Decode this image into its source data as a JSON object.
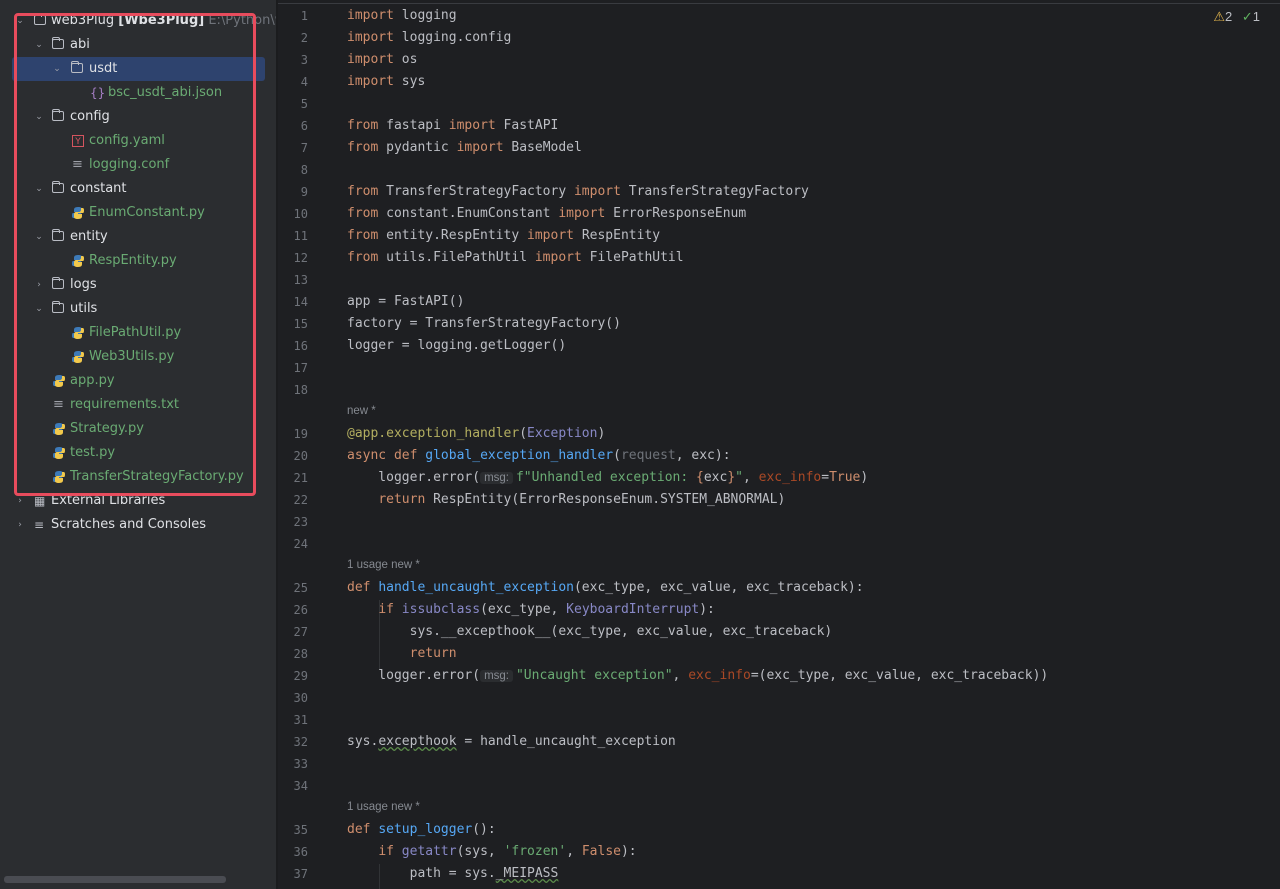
{
  "sidebar": {
    "project": {
      "name": "web3Plug",
      "module": "[Wbe3Plug]",
      "path": "E:\\Python\\we"
    },
    "items": [
      {
        "label": "abi",
        "kind": "folder"
      },
      {
        "label": "usdt",
        "kind": "folder",
        "selected": true
      },
      {
        "label": "bsc_usdt_abi.json",
        "kind": "json-file"
      },
      {
        "label": "config",
        "kind": "folder"
      },
      {
        "label": "config.yaml",
        "kind": "yaml-file"
      },
      {
        "label": "logging.conf",
        "kind": "text-file"
      },
      {
        "label": "constant",
        "kind": "folder"
      },
      {
        "label": "EnumConstant.py",
        "kind": "python-file"
      },
      {
        "label": "entity",
        "kind": "folder"
      },
      {
        "label": "RespEntity.py",
        "kind": "python-file"
      },
      {
        "label": "logs",
        "kind": "folder"
      },
      {
        "label": "utils",
        "kind": "folder"
      },
      {
        "label": "FilePathUtil.py",
        "kind": "python-file"
      },
      {
        "label": "Web3Utils.py",
        "kind": "python-file"
      },
      {
        "label": "app.py",
        "kind": "python-file"
      },
      {
        "label": "requirements.txt",
        "kind": "text-file"
      },
      {
        "label": "Strategy.py",
        "kind": "python-file"
      },
      {
        "label": "test.py",
        "kind": "python-file"
      },
      {
        "label": "TransferStrategyFactory.py",
        "kind": "python-file"
      }
    ],
    "external_libraries": "External Libraries",
    "scratches": "Scratches and Consoles",
    "colors": {
      "highlight_border": "#e84c5d",
      "selection": "#2e436e",
      "file_green": "#6aab73"
    }
  },
  "editor": {
    "status": {
      "warnings": "2",
      "ok_count": "1"
    },
    "hints": {
      "new": "new *",
      "usage_new": "1 usage   new *"
    },
    "inlay": {
      "msg": "msg:"
    },
    "line_numbers": [
      "1",
      "2",
      "3",
      "4",
      "5",
      "6",
      "7",
      "8",
      "9",
      "10",
      "11",
      "12",
      "13",
      "14",
      "15",
      "16",
      "17",
      "18",
      "19",
      "20",
      "21",
      "22",
      "23",
      "24",
      "25",
      "26",
      "27",
      "28",
      "29",
      "30",
      "31",
      "32",
      "33",
      "34",
      "35",
      "36",
      "37"
    ]
  }
}
